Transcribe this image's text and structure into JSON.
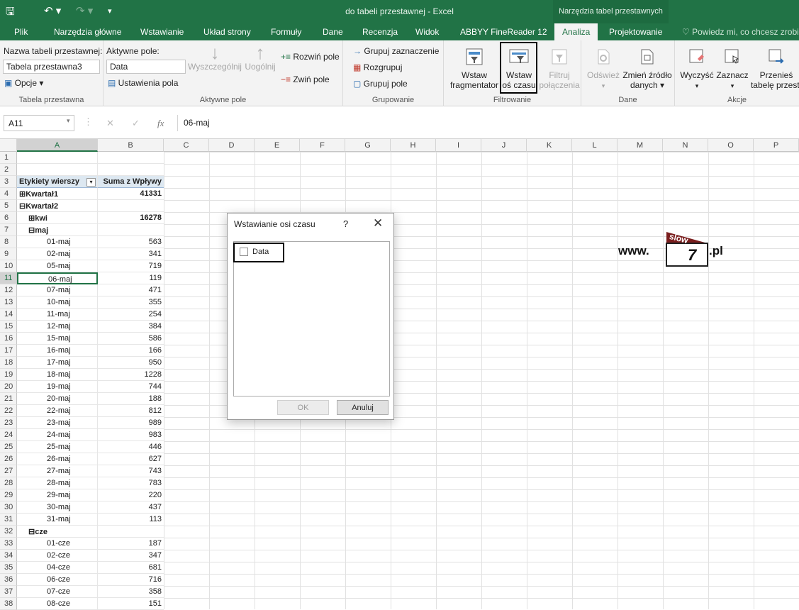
{
  "window": {
    "title": "do tabeli przestawnej - Excel",
    "context_band": "Narzędzia tabel przestawnych",
    "qa_save": "🖫",
    "qa_undo": "↶ ▾",
    "qa_redo": "↷ ▾",
    "qa_custom": "▾"
  },
  "tabs": [
    "Plik",
    "Narzędzia główne",
    "Wstawianie",
    "Układ strony",
    "Formuły",
    "Dane",
    "Recenzja",
    "Widok",
    "ABBYY FineReader 12",
    "Analiza",
    "Projektowanie",
    "Powiedz mi, co chcesz zrobić"
  ],
  "ribbon": {
    "pivot_name_label": "Nazwa tabeli przestawnej:",
    "pivot_name_value": "Tabela przestawna3",
    "options": "Opcje ▾",
    "group1": "Tabela przestawna",
    "active_field_label": "Aktywne pole:",
    "active_field_value": "Data",
    "field_settings": "Ustawienia pola",
    "drill_down": "Wyszczególnij",
    "drill_up": "Uogólnij",
    "expand": "Rozwiń pole",
    "collapse": "Zwiń pole",
    "group2": "Aktywne pole",
    "group_selection": "Grupuj zaznaczenie",
    "ungroup": "Rozgrupuj",
    "group_field": "Grupuj pole",
    "group3": "Grupowanie",
    "slicer_l1": "Wstaw",
    "slicer_l2": "fragmentator",
    "timeline_l1": "Wstaw",
    "timeline_l2": "oś czasu",
    "filter_l1": "Filtruj",
    "filter_l2": "połączenia",
    "group4": "Filtrowanie",
    "refresh": "Odśwież",
    "change_l1": "Zmień źródło",
    "change_l2": "danych ▾",
    "group5": "Dane",
    "clear": "Wyczyść",
    "select": "Zaznacz",
    "move_l1": "Przenieś",
    "move_l2": "tabelę przest.",
    "group6": "Akcje"
  },
  "formula": {
    "name_box": "A11",
    "fx": "fx",
    "value": "06-maj"
  },
  "columns": [
    "A",
    "B",
    "C",
    "D",
    "E",
    "F",
    "G",
    "H",
    "I",
    "J",
    "K",
    "L",
    "M",
    "N",
    "O",
    "P"
  ],
  "rows": [
    {
      "n": "1",
      "a": "",
      "b": ""
    },
    {
      "n": "2",
      "a": "",
      "b": ""
    },
    {
      "n": "3",
      "a": "Etykiety wierszy",
      "b": "Suma z Wpływy"
    },
    {
      "n": "4",
      "a": "⊞Kwartał1",
      "b": "41331"
    },
    {
      "n": "5",
      "a": "⊟Kwartał2",
      "b": ""
    },
    {
      "n": "6",
      "a": "⊞kwi",
      "b": "16278"
    },
    {
      "n": "7",
      "a": "⊟maj",
      "b": ""
    },
    {
      "n": "8",
      "a": "01-maj",
      "b": "563"
    },
    {
      "n": "9",
      "a": "02-maj",
      "b": "341"
    },
    {
      "n": "10",
      "a": "05-maj",
      "b": "719"
    },
    {
      "n": "11",
      "a": "06-maj",
      "b": "119"
    },
    {
      "n": "12",
      "a": "07-maj",
      "b": "471"
    },
    {
      "n": "13",
      "a": "10-maj",
      "b": "355"
    },
    {
      "n": "14",
      "a": "11-maj",
      "b": "254"
    },
    {
      "n": "15",
      "a": "12-maj",
      "b": "384"
    },
    {
      "n": "16",
      "a": "15-maj",
      "b": "586"
    },
    {
      "n": "17",
      "a": "16-maj",
      "b": "166"
    },
    {
      "n": "18",
      "a": "17-maj",
      "b": "950"
    },
    {
      "n": "19",
      "a": "18-maj",
      "b": "1228"
    },
    {
      "n": "20",
      "a": "19-maj",
      "b": "744"
    },
    {
      "n": "21",
      "a": "20-maj",
      "b": "188"
    },
    {
      "n": "22",
      "a": "22-maj",
      "b": "812"
    },
    {
      "n": "23",
      "a": "23-maj",
      "b": "989"
    },
    {
      "n": "24",
      "a": "24-maj",
      "b": "983"
    },
    {
      "n": "25",
      "a": "25-maj",
      "b": "446"
    },
    {
      "n": "26",
      "a": "26-maj",
      "b": "627"
    },
    {
      "n": "27",
      "a": "27-maj",
      "b": "743"
    },
    {
      "n": "28",
      "a": "28-maj",
      "b": "783"
    },
    {
      "n": "29",
      "a": "29-maj",
      "b": "220"
    },
    {
      "n": "30",
      "a": "30-maj",
      "b": "437"
    },
    {
      "n": "31",
      "a": "31-maj",
      "b": "113"
    },
    {
      "n": "32",
      "a": "⊟cze",
      "b": ""
    },
    {
      "n": "33",
      "a": "01-cze",
      "b": "187"
    },
    {
      "n": "34",
      "a": "02-cze",
      "b": "347"
    },
    {
      "n": "35",
      "a": "04-cze",
      "b": "681"
    },
    {
      "n": "36",
      "a": "06-cze",
      "b": "716"
    },
    {
      "n": "37",
      "a": "07-cze",
      "b": "358"
    },
    {
      "n": "38",
      "a": "08-cze",
      "b": "151"
    }
  ],
  "dialog": {
    "title": "Wstawianie osi czasu",
    "help": "?",
    "close": "✕",
    "field": "Data",
    "ok": "OK",
    "cancel": "Anuluj"
  },
  "logo": {
    "prefix": "www.",
    "flag": "slow",
    "digit": "7",
    "suffix": ".pl"
  }
}
